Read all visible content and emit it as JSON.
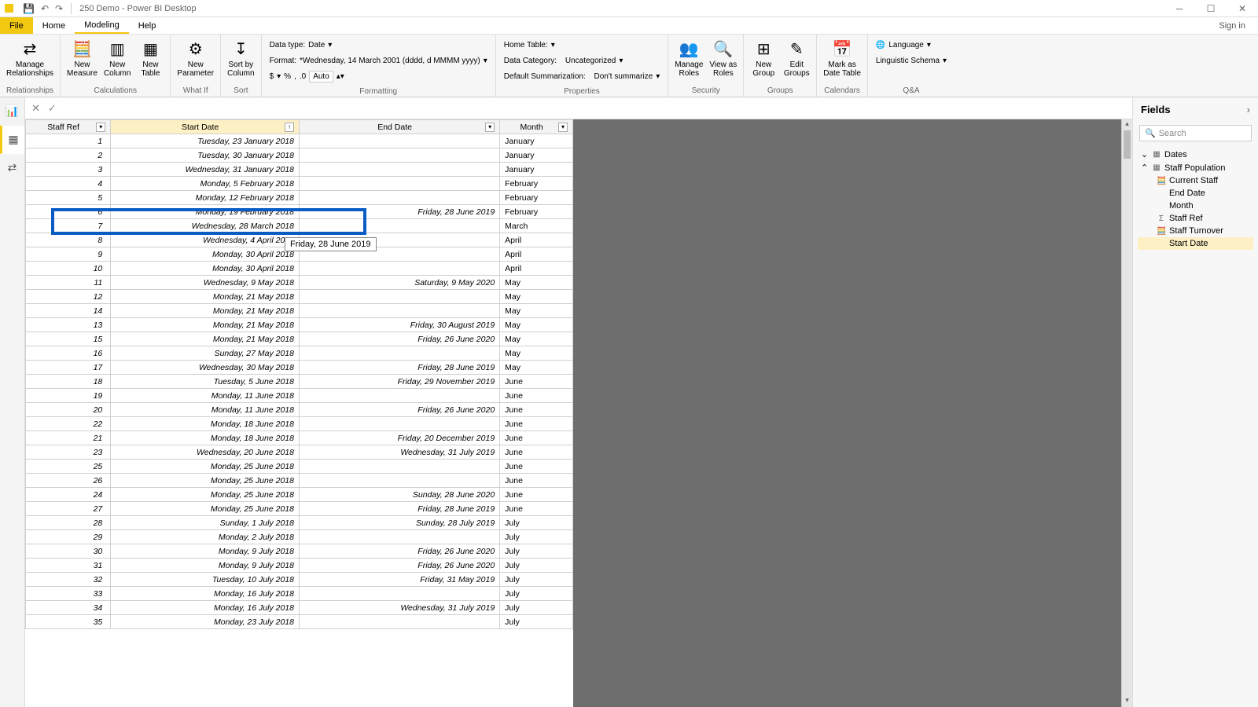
{
  "app": {
    "title": "250 Demo - Power BI Desktop"
  },
  "menubar": {
    "file": "File",
    "home": "Home",
    "modeling": "Modeling",
    "help": "Help",
    "signin": "Sign in"
  },
  "ribbon": {
    "relationships": {
      "manage": "Manage\nRelationships",
      "group": "Relationships"
    },
    "calculations": {
      "measure": "New\nMeasure",
      "column": "New\nColumn",
      "table": "New\nTable",
      "group": "Calculations"
    },
    "whatif": {
      "param": "New\nParameter",
      "group": "What If"
    },
    "sort": {
      "sortby": "Sort by\nColumn",
      "group": "Sort"
    },
    "formatting": {
      "datatype_label": "Data type:",
      "datatype_val": "Date",
      "format_label": "Format:",
      "format_val": "*Wednesday, 14 March 2001 (dddd, d MMMM yyyy)",
      "curr": "$",
      "pct": "%",
      "comma": ",",
      "dec": ".0",
      "auto": "Auto",
      "group": "Formatting"
    },
    "properties": {
      "hometable_label": "Home Table:",
      "datacat_label": "Data Category:",
      "datacat_val": "Uncategorized",
      "summ_label": "Default Summarization:",
      "summ_val": "Don't summarize",
      "group": "Properties"
    },
    "security": {
      "manage": "Manage\nRoles",
      "viewas": "View as\nRoles",
      "group": "Security"
    },
    "groups": {
      "new": "New\nGroup",
      "edit": "Edit\nGroups",
      "group": "Groups"
    },
    "calendars": {
      "mark": "Mark as\nDate Table",
      "group": "Calendars"
    },
    "qa": {
      "lang": "Language",
      "schema": "Linguistic Schema",
      "group": "Q&A"
    }
  },
  "columns": {
    "staffref": "Staff Ref",
    "startdate": "Start Date",
    "enddate": "End Date",
    "month": "Month"
  },
  "rows": [
    {
      "ref": "1",
      "start": "Tuesday, 23 January 2018",
      "end": "",
      "month": "January"
    },
    {
      "ref": "2",
      "start": "Tuesday, 30 January 2018",
      "end": "",
      "month": "January"
    },
    {
      "ref": "3",
      "start": "Wednesday, 31 January 2018",
      "end": "",
      "month": "January"
    },
    {
      "ref": "4",
      "start": "Monday, 5 February 2018",
      "end": "",
      "month": "February"
    },
    {
      "ref": "5",
      "start": "Monday, 12 February 2018",
      "end": "",
      "month": "February"
    },
    {
      "ref": "6",
      "start": "Monday, 19 February 2018",
      "end": "Friday, 28 June 2019",
      "month": "February"
    },
    {
      "ref": "7",
      "start": "Wednesday, 28 March 2018",
      "end": "",
      "month": "March"
    },
    {
      "ref": "8",
      "start": "Wednesday, 4 April 2018",
      "end": "",
      "month": "April"
    },
    {
      "ref": "9",
      "start": "Monday, 30 April 2018",
      "end": "",
      "month": "April"
    },
    {
      "ref": "10",
      "start": "Monday, 30 April 2018",
      "end": "",
      "month": "April"
    },
    {
      "ref": "11",
      "start": "Wednesday, 9 May 2018",
      "end": "Saturday, 9 May 2020",
      "month": "May"
    },
    {
      "ref": "12",
      "start": "Monday, 21 May 2018",
      "end": "",
      "month": "May"
    },
    {
      "ref": "14",
      "start": "Monday, 21 May 2018",
      "end": "",
      "month": "May"
    },
    {
      "ref": "13",
      "start": "Monday, 21 May 2018",
      "end": "Friday, 30 August 2019",
      "month": "May"
    },
    {
      "ref": "15",
      "start": "Monday, 21 May 2018",
      "end": "Friday, 26 June 2020",
      "month": "May"
    },
    {
      "ref": "16",
      "start": "Sunday, 27 May 2018",
      "end": "",
      "month": "May"
    },
    {
      "ref": "17",
      "start": "Wednesday, 30 May 2018",
      "end": "Friday, 28 June 2019",
      "month": "May"
    },
    {
      "ref": "18",
      "start": "Tuesday, 5 June 2018",
      "end": "Friday, 29 November 2019",
      "month": "June"
    },
    {
      "ref": "19",
      "start": "Monday, 11 June 2018",
      "end": "",
      "month": "June"
    },
    {
      "ref": "20",
      "start": "Monday, 11 June 2018",
      "end": "Friday, 26 June 2020",
      "month": "June"
    },
    {
      "ref": "22",
      "start": "Monday, 18 June 2018",
      "end": "",
      "month": "June"
    },
    {
      "ref": "21",
      "start": "Monday, 18 June 2018",
      "end": "Friday, 20 December 2019",
      "month": "June"
    },
    {
      "ref": "23",
      "start": "Wednesday, 20 June 2018",
      "end": "Wednesday, 31 July 2019",
      "month": "June"
    },
    {
      "ref": "25",
      "start": "Monday, 25 June 2018",
      "end": "",
      "month": "June"
    },
    {
      "ref": "26",
      "start": "Monday, 25 June 2018",
      "end": "",
      "month": "June"
    },
    {
      "ref": "24",
      "start": "Monday, 25 June 2018",
      "end": "Sunday, 28 June 2020",
      "month": "June"
    },
    {
      "ref": "27",
      "start": "Monday, 25 June 2018",
      "end": "Friday, 28 June 2019",
      "month": "June"
    },
    {
      "ref": "28",
      "start": "Sunday, 1 July 2018",
      "end": "Sunday, 28 July 2019",
      "month": "July"
    },
    {
      "ref": "29",
      "start": "Monday, 2 July 2018",
      "end": "",
      "month": "July"
    },
    {
      "ref": "30",
      "start": "Monday, 9 July 2018",
      "end": "Friday, 26 June 2020",
      "month": "July"
    },
    {
      "ref": "31",
      "start": "Monday, 9 July 2018",
      "end": "Friday, 26 June 2020",
      "month": "July"
    },
    {
      "ref": "32",
      "start": "Tuesday, 10 July 2018",
      "end": "Friday, 31 May 2019",
      "month": "July"
    },
    {
      "ref": "33",
      "start": "Monday, 16 July 2018",
      "end": "",
      "month": "July"
    },
    {
      "ref": "34",
      "start": "Monday, 16 July 2018",
      "end": "Wednesday, 31 July 2019",
      "month": "July"
    },
    {
      "ref": "35",
      "start": "Monday, 23 July 2018",
      "end": "",
      "month": "July"
    }
  ],
  "tooltip": "Friday, 28 June 2019",
  "fields": {
    "title": "Fields",
    "search_ph": "Search",
    "tables": {
      "dates": "Dates",
      "staffpop": "Staff Population",
      "items": {
        "currentstaff": "Current Staff",
        "enddate": "End Date",
        "month": "Month",
        "staffref": "Staff Ref",
        "turnover": "Staff Turnover",
        "startdate": "Start Date"
      }
    }
  }
}
